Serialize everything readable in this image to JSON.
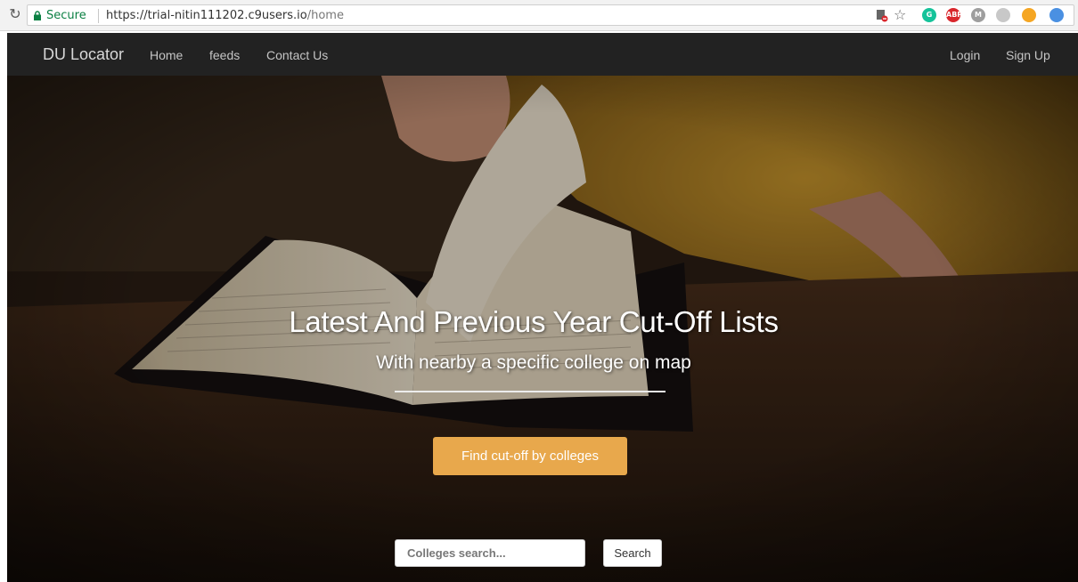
{
  "browser": {
    "secure_label": "Secure",
    "url_scheme": "https://",
    "url_host": "trial-nitin111202.c9users.io",
    "url_path": "/home",
    "extensions": [
      {
        "name": "grammarly",
        "label": "G",
        "color": "#15c39a"
      },
      {
        "name": "adblock-plus",
        "label": "ABP",
        "color": "#d9262c"
      },
      {
        "name": "extension-m",
        "label": "M",
        "color": "#9e9e9e"
      },
      {
        "name": "globe-extension",
        "label": "",
        "color": "#c8c8c8"
      },
      {
        "name": "wrench-extension",
        "label": "",
        "color": "#f5a623"
      },
      {
        "name": "close-circle-extension",
        "label": "",
        "color": "#4a90e2"
      }
    ]
  },
  "navbar": {
    "brand": "DU Locator",
    "links": [
      "Home",
      "feeds",
      "Contact Us"
    ],
    "right_links": [
      "Login",
      "Sign Up"
    ]
  },
  "hero": {
    "title": "Latest And Previous Year Cut-Off Lists",
    "subtitle": "With nearby a specific college on map",
    "cta_label": "Find cut-off by colleges",
    "cta_color": "#e8a84c",
    "search": {
      "placeholder": "Colleges search...",
      "button_label": "Search"
    }
  }
}
